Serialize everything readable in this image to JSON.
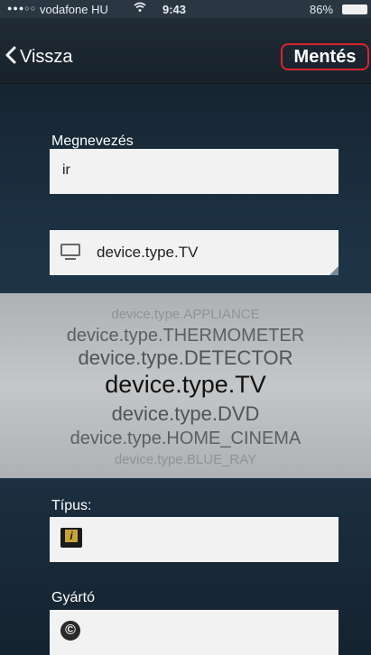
{
  "status_bar": {
    "signal_dots": "●●●○○",
    "carrier": "vodafone HU",
    "wifi_icon": "wifi-icon",
    "time": "9:43",
    "battery": "86%"
  },
  "nav": {
    "back_label": "Vissza",
    "save_label": "Mentés",
    "save_highlight_color": "#d9262b"
  },
  "form": {
    "name_label": "Megnevezés",
    "name_value": "ir",
    "device_type_value": "device.type.TV",
    "type_label": "Típus:",
    "manufacturer_label": "Gyártó"
  },
  "picker": {
    "options": [
      "device.type.APPLIANCE",
      "device.type.THERMOMETER",
      "device.type.DETECTOR",
      "device.type.TV",
      "device.type.DVD",
      "device.type.HOME_CINEMA",
      "device.type.BLUE_RAY"
    ],
    "selected": "device.type.TV"
  },
  "icons": {
    "tv": "tv-icon",
    "type": "info-icon",
    "manufacturer": "copyright-icon"
  }
}
